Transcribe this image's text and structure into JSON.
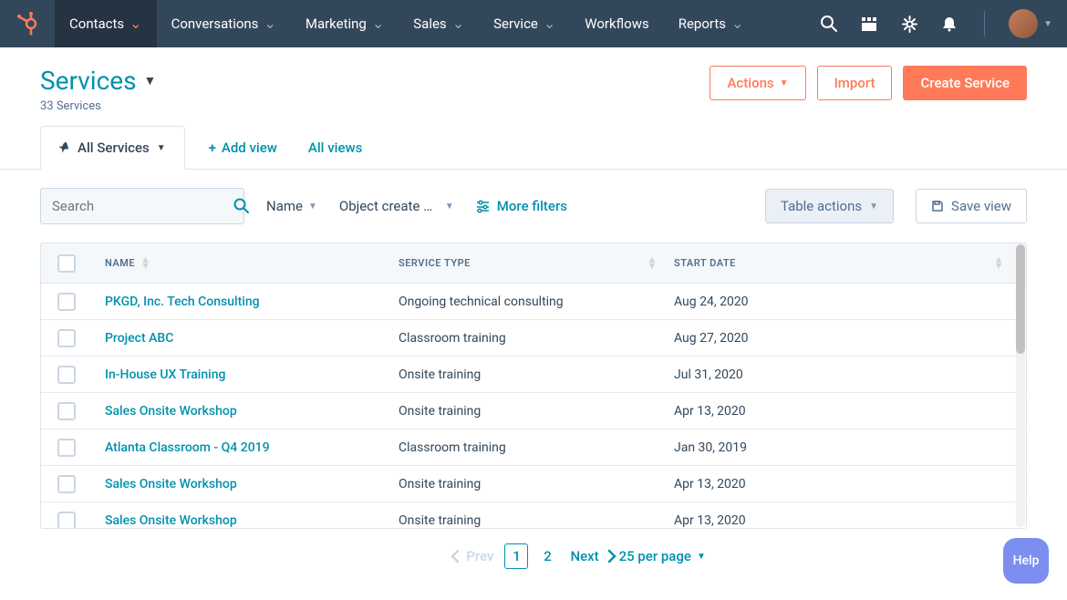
{
  "nav": {
    "items": [
      {
        "label": "Contacts",
        "active": true
      },
      {
        "label": "Conversations"
      },
      {
        "label": "Marketing"
      },
      {
        "label": "Sales"
      },
      {
        "label": "Service"
      },
      {
        "label": "Workflows",
        "no_caret": true
      },
      {
        "label": "Reports"
      }
    ]
  },
  "header": {
    "title": "Services",
    "subtitle": "33 Services",
    "actions_label": "Actions",
    "import_label": "Import",
    "create_label": "Create Service"
  },
  "tabs": {
    "active_label": "All Services",
    "add_view_label": "Add view",
    "all_views_label": "All views"
  },
  "filters": {
    "search_placeholder": "Search",
    "name_label": "Name",
    "object_create_label": "Object create d…",
    "more_filters_label": "More filters",
    "table_actions_label": "Table actions",
    "save_view_label": "Save view"
  },
  "table": {
    "headers": {
      "name": "NAME",
      "type": "SERVICE TYPE",
      "date": "START DATE"
    },
    "rows": [
      {
        "name": "PKGD, Inc. Tech Consulting",
        "type": "Ongoing technical consulting",
        "date": "Aug 24, 2020"
      },
      {
        "name": "Project ABC",
        "type": "Classroom training",
        "date": "Aug 27, 2020"
      },
      {
        "name": "In-House UX Training",
        "type": "Onsite training",
        "date": "Jul 31, 2020"
      },
      {
        "name": "Sales Onsite Workshop",
        "type": "Onsite training",
        "date": "Apr 13, 2020"
      },
      {
        "name": "Atlanta Classroom - Q4 2019",
        "type": "Classroom training",
        "date": "Jan 30, 2019"
      },
      {
        "name": "Sales Onsite Workshop",
        "type": "Onsite training",
        "date": "Apr 13, 2020"
      },
      {
        "name": "Sales Onsite Workshop",
        "type": "Onsite training",
        "date": "Apr 13, 2020"
      }
    ]
  },
  "pagination": {
    "prev_label": "Prev",
    "pages": [
      "1",
      "2"
    ],
    "current": "1",
    "next_label": "Next",
    "per_page_label": "25 per page"
  },
  "help_label": "Help"
}
